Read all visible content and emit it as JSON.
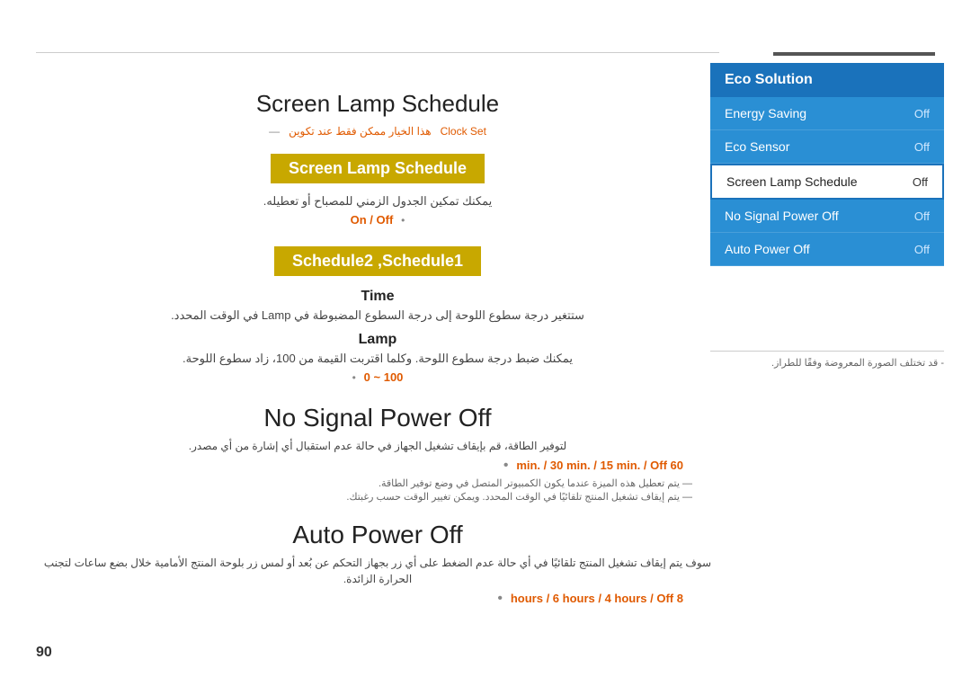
{
  "page": {
    "number": "90"
  },
  "top_line": {},
  "main": {
    "section1": {
      "title": "Screen Lamp Schedule",
      "clock_note_arabic": "هذا الخيار ممكن فقط عند تكوين",
      "clock_note_link": "Clock Set",
      "highlight1": "Screen Lamp Schedule",
      "arabic_desc1": "يمكنك تمكين الجدول الزمني للمصباح أو تعطيله.",
      "on_off": "On / Off",
      "highlight2": "Schedule2 ,Schedule1",
      "subsection_time_title": "Time",
      "subsection_time_arabic": "ستتغير درجة سطوع اللوحة إلى درجة السطوع المضبوطة في Lamp في الوقت المحدد.",
      "subsection_lamp_title": "Lamp",
      "subsection_lamp_arabic": "يمكنك ضبط درجة سطوع اللوحة. وكلما اقتربت القيمة من 100، زاد سطوع اللوحة.",
      "lamp_range": "100 ~ 0"
    },
    "section2": {
      "title": "No Signal Power Off",
      "arabic_desc": "لتوفير الطاقة، قم بإيقاف تشغيل الجهاز في حالة عدم استقبال أي إشارة من أي مصدر.",
      "options": "60 min. / 30 min. / 15 min. / Off",
      "note1": "يتم تعطيل هذه الميزة عندما يكون الكمبيوتر المتصل في وضع توفير الطاقة.",
      "note2": "يتم إيقاف تشغيل المنتج تلقائيًا في الوقت المحدد. ويمكن تغيير الوقت حسب رغبتك."
    },
    "section3": {
      "title": "Auto Power Off",
      "arabic_desc": "سوف يتم إيقاف تشغيل المنتج تلقائيًا في أي حالة عدم الضغط على أي زر بجهاز التحكم عن بُعد أو لمس زر بلوحة المنتج الأمامية خلال بضع ساعات لتجنب الحرارة الزائدة.",
      "options": "8 hours / 6 hours / 4 hours / Off",
      "hours1": "8 hours",
      "hours2": "6 hours",
      "hours3": "4 hours"
    }
  },
  "sidebar": {
    "header": "Eco Solution",
    "items": [
      {
        "label": "Energy Saving",
        "value": "Off",
        "active": false
      },
      {
        "label": "Eco Sensor",
        "value": "Off",
        "active": false
      },
      {
        "label": "Screen Lamp Schedule",
        "value": "Off",
        "active": true
      },
      {
        "label": "No Signal Power Off",
        "value": "Off",
        "active": false
      },
      {
        "label": "Auto Power Off",
        "value": "Off",
        "active": false
      }
    ],
    "note": "قد تختلف الصورة المعروضة وفقًا للطراز."
  }
}
